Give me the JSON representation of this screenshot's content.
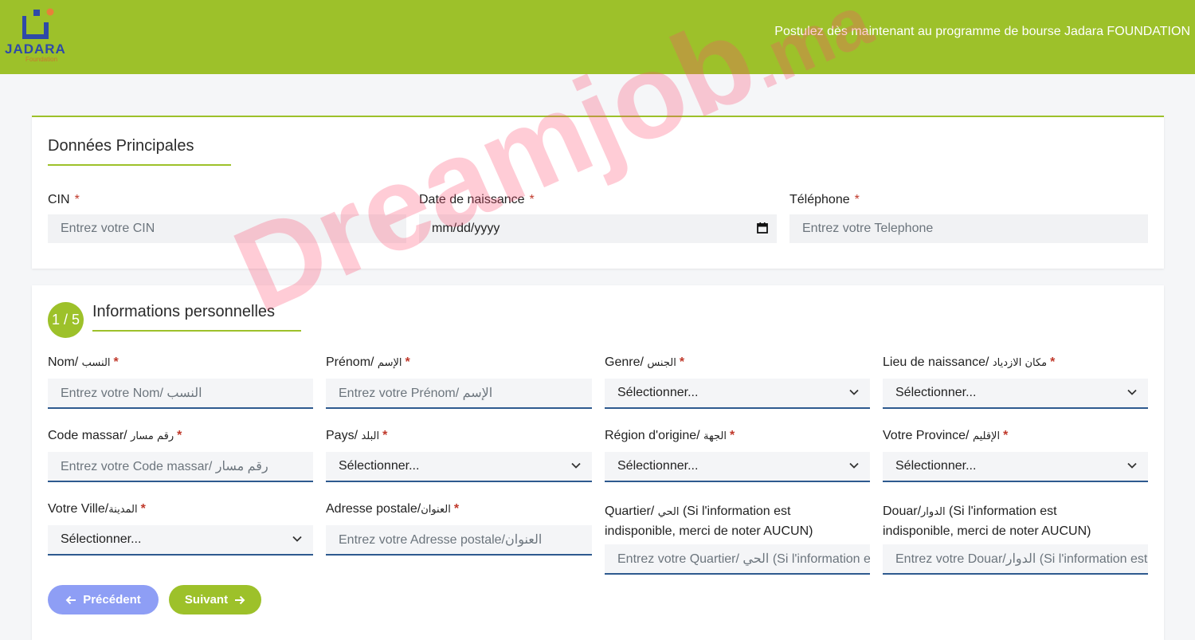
{
  "header": {
    "logo_text": "JADARA",
    "logo_sub": "Foundation",
    "tagline": "Postulez dès maintenant au programme de bourse Jadara FOUNDATION"
  },
  "section_main": {
    "title": "Données Principales",
    "fields": {
      "cin": {
        "label": "CIN",
        "placeholder": "Entrez votre CIN"
      },
      "birthdate": {
        "label": "Date de naissance",
        "value": "mm/dd/yyyy"
      },
      "phone": {
        "label": "Téléphone",
        "placeholder": "Entrez votre Telephone"
      }
    }
  },
  "section_personal": {
    "step": "1 / 5",
    "title": "Informations personnelles",
    "fields": {
      "nom": {
        "label": "Nom/ ",
        "label_ar": "النسب",
        "placeholder": "Entrez votre Nom/ النسب"
      },
      "prenom": {
        "label": "Prénom/ ",
        "label_ar": "الإسم",
        "placeholder": "Entrez votre Prénom/ الإسم"
      },
      "genre": {
        "label": "Genre/ ",
        "label_ar": "الجنس",
        "value": "Sélectionner..."
      },
      "lieu": {
        "label": "Lieu de naissance/ ",
        "label_ar": "مكان الازدياد",
        "value": "Sélectionner..."
      },
      "massar": {
        "label": "Code massar/ ",
        "label_ar": "رقم مسار",
        "placeholder": "Entrez votre Code massar/ رقم مسار"
      },
      "pays": {
        "label": "Pays/ ",
        "label_ar": "البلد",
        "value": "Sélectionner..."
      },
      "region": {
        "label": "Région d'origine/ ",
        "label_ar": "الجهة",
        "value": "Sélectionner..."
      },
      "province": {
        "label": "Votre Province/ ",
        "label_ar": "الإقليم",
        "value": "Sélectionner..."
      },
      "ville": {
        "label": "Votre Ville/",
        "label_ar": "المدينة",
        "value": "Sélectionner..."
      },
      "adresse": {
        "label": "Adresse postale/",
        "label_ar": "العنوان",
        "placeholder": "Entrez votre Adresse postale/العنوان"
      },
      "quartier": {
        "label_line1_a": "Quartier/ ",
        "label_ar": "الحي",
        "label_line1_b": " (Si l'information est",
        "label_line2": "indisponible, merci de noter AUCUN)",
        "placeholder": "Entrez votre Quartier/ الحي (Si l'information est indisponible, merci de noter AUCUN)"
      },
      "douar": {
        "label_line1_a": "Douar/",
        "label_ar": "الدوار",
        "label_line1_b": " (Si l'information est",
        "label_line2": "indisponible, merci de noter AUCUN)",
        "placeholder": "Entrez votre Douar/الدوار (Si l'information est indisponible, merci de noter AUCUN)"
      }
    },
    "buttons": {
      "prev": "Précédent",
      "next": "Suivant"
    }
  },
  "watermark": {
    "main": "Dreamjob",
    "suffix": ".ma"
  },
  "colors": {
    "brand_green": "#9dc12a",
    "input_border": "#2e5a8f",
    "prev_button": "#8e9ef5",
    "required": "#c0392b"
  },
  "icons": {
    "select": "chevron-down-icon",
    "date": "calendar-icon",
    "prev": "arrow-left-icon",
    "next": "arrow-right-icon"
  }
}
